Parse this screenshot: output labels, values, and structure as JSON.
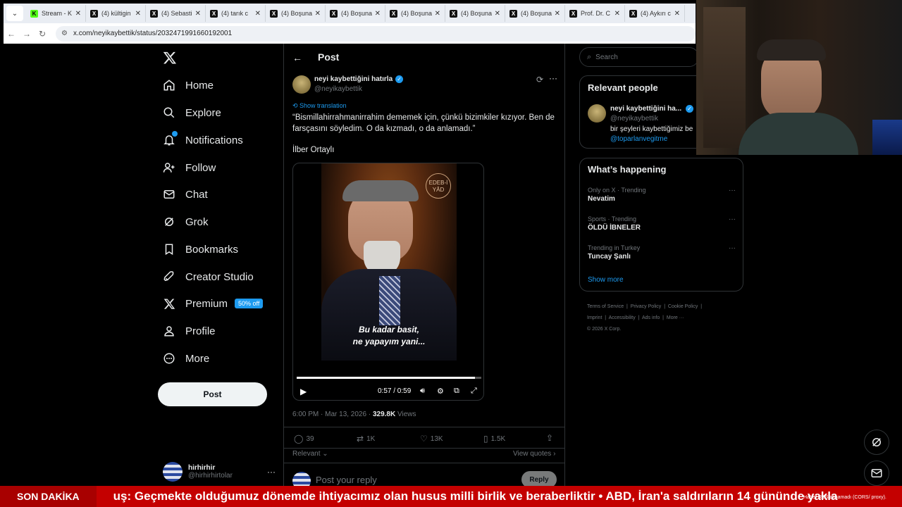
{
  "browser": {
    "tabs": [
      {
        "title": "Stream - K",
        "fav": "K"
      },
      {
        "title": "(4) kültigin",
        "fav": "X"
      },
      {
        "title": "(4) Sebasti",
        "fav": "X"
      },
      {
        "title": "(4) tarık c",
        "fav": "X"
      },
      {
        "title": "(4) Boşuna",
        "fav": "X"
      },
      {
        "title": "(4) Boşuna",
        "fav": "X"
      },
      {
        "title": "(4) Boşuna",
        "fav": "X"
      },
      {
        "title": "(4) Boşuna",
        "fav": "X"
      },
      {
        "title": "(4) Boşuna",
        "fav": "X"
      },
      {
        "title": "Prof. Dr. C",
        "fav": "X"
      },
      {
        "title": "(4) Aykırı c",
        "fav": "X"
      }
    ],
    "url": "x.com/neyikaybettik/status/2032471991660192001"
  },
  "nav": {
    "home": "Home",
    "explore": "Explore",
    "notifications": "Notifications",
    "follow": "Follow",
    "chat": "Chat",
    "grok": "Grok",
    "bookmarks": "Bookmarks",
    "creator_studio": "Creator Studio",
    "premium": "Premium",
    "premium_badge": "50% off",
    "profile": "Profile",
    "more": "More",
    "post_button": "Post"
  },
  "account": {
    "name": "hirhirhir",
    "handle": "@hirhirhirtolar"
  },
  "post": {
    "header": "Post",
    "author_name": "neyi kaybettiğini hatırla",
    "author_handle": "@neyikaybettik",
    "show_translation": "Show translation",
    "text": "“Bismillahirrahmanirrahim dememek için, çünkü bizimkiler kızıyor. Ben de farsçasını söyledim. O da kızmadı, o da anlamadı.”",
    "text2": "İlber Ortaylı",
    "video_watermark": "EDEB-İ YÂD",
    "subtitle_line1": "Bu kadar basit,",
    "subtitle_line2": "ne yapayım yani...",
    "video_time": "0:57 / 0:59",
    "video_progress": 0.966,
    "timestamp": "6:00 PM · Mar 13, 2026 · ",
    "views_count": "329.8K",
    "views_label": " Views",
    "replies": "39",
    "reposts": "1K",
    "likes": "13K",
    "bookmarks": "1.5K",
    "sort_label": "Relevant",
    "view_quotes": "View quotes",
    "reply_placeholder": "Post your reply",
    "reply_button": "Reply"
  },
  "sidebar": {
    "search_placeholder": "Search",
    "relevant_title": "Relevant people",
    "person_name": "neyi kaybettiğini ha...",
    "person_handle": "@neyikaybettik",
    "person_bio": "bir şeyleri kaybettiğimiz be",
    "person_link": "@toparlanvegitme",
    "happening_title": "What’s happening",
    "trends": [
      {
        "meta": "Only on X · Trending",
        "name": "Nevatim"
      },
      {
        "meta": "Sports · Trending",
        "name": "ÖLDÜ İBNELER"
      },
      {
        "meta": "Trending in Turkey",
        "name": "Tuncay Şanlı"
      }
    ],
    "show_more": "Show more",
    "footer": {
      "tos": "Terms of Service",
      "privacy": "Privacy Policy",
      "cookie": "Cookie Policy",
      "imprint": "Imprint",
      "accessibility": "Accessibility",
      "ads": "Ads info",
      "more": "More ···",
      "copyright": "© 2026 X Corp."
    }
  },
  "ticker": {
    "label": "SON DAKİKA",
    "text": "uş: Geçmekte olduğumuz dönemde ihtiyacımız olan husus milli birlik ve beraberliktir   •   ABD, İran'a saldırıların 14 gününde yakla",
    "rss_note": "Haber RSS alınamadı (CORS/ proxy)."
  },
  "colors": {
    "accent": "#1d9bf0",
    "ticker": "#c40000",
    "background": "#000000"
  }
}
